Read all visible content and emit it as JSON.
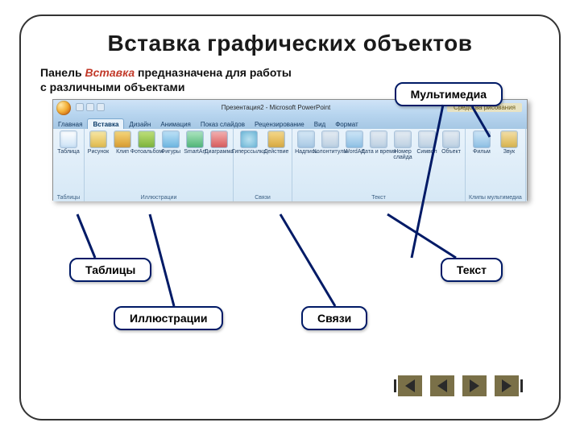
{
  "title": "Вставка графических объектов",
  "description": {
    "pre": "Панель ",
    "em": "Вставка",
    "post": " предназначена для работы с различными объектами"
  },
  "callouts": {
    "multimedia": "Мультимедиа",
    "tables": "Таблицы",
    "text": "Текст",
    "illustrations": "Иллюстрации",
    "links": "Связи"
  },
  "ribbon": {
    "window_title": "Презентация2 - Microsoft PowerPoint",
    "context_title": "Средства рисования",
    "tabs": [
      "Главная",
      "Вставка",
      "Дизайн",
      "Анимация",
      "Показ слайдов",
      "Рецензирование",
      "Вид",
      "Формат"
    ],
    "active_tab_index": 1,
    "groups": [
      {
        "name": "Таблицы",
        "buttons": [
          {
            "label": "Таблица",
            "icon": "table"
          }
        ]
      },
      {
        "name": "Иллюстрации",
        "buttons": [
          {
            "label": "Рисунок",
            "icon": "pic"
          },
          {
            "label": "Клип",
            "icon": "clip"
          },
          {
            "label": "Фотоальбом",
            "icon": "album"
          },
          {
            "label": "Фигуры",
            "icon": "shape"
          },
          {
            "label": "SmartArt",
            "icon": "smart"
          },
          {
            "label": "Диаграмма",
            "icon": "chart"
          }
        ]
      },
      {
        "name": "Связи",
        "buttons": [
          {
            "label": "Гиперссылка",
            "icon": "link"
          },
          {
            "label": "Действие",
            "icon": "action"
          }
        ]
      },
      {
        "name": "Текст",
        "buttons": [
          {
            "label": "Надпись",
            "icon": "tbox"
          },
          {
            "label": "Колонтитулы",
            "icon": "hf"
          },
          {
            "label": "WordArt",
            "icon": "wart"
          },
          {
            "label": "Дата и время",
            "icon": "date",
            "two": true
          },
          {
            "label": "Номер слайда",
            "icon": "sym",
            "two": true
          },
          {
            "label": "Символ",
            "icon": "sym"
          },
          {
            "label": "Объект",
            "icon": "obj"
          }
        ]
      },
      {
        "name": "Клипы мультимедиа",
        "buttons": [
          {
            "label": "Фильм",
            "icon": "movie"
          },
          {
            "label": "Звук",
            "icon": "sound"
          }
        ]
      }
    ]
  }
}
